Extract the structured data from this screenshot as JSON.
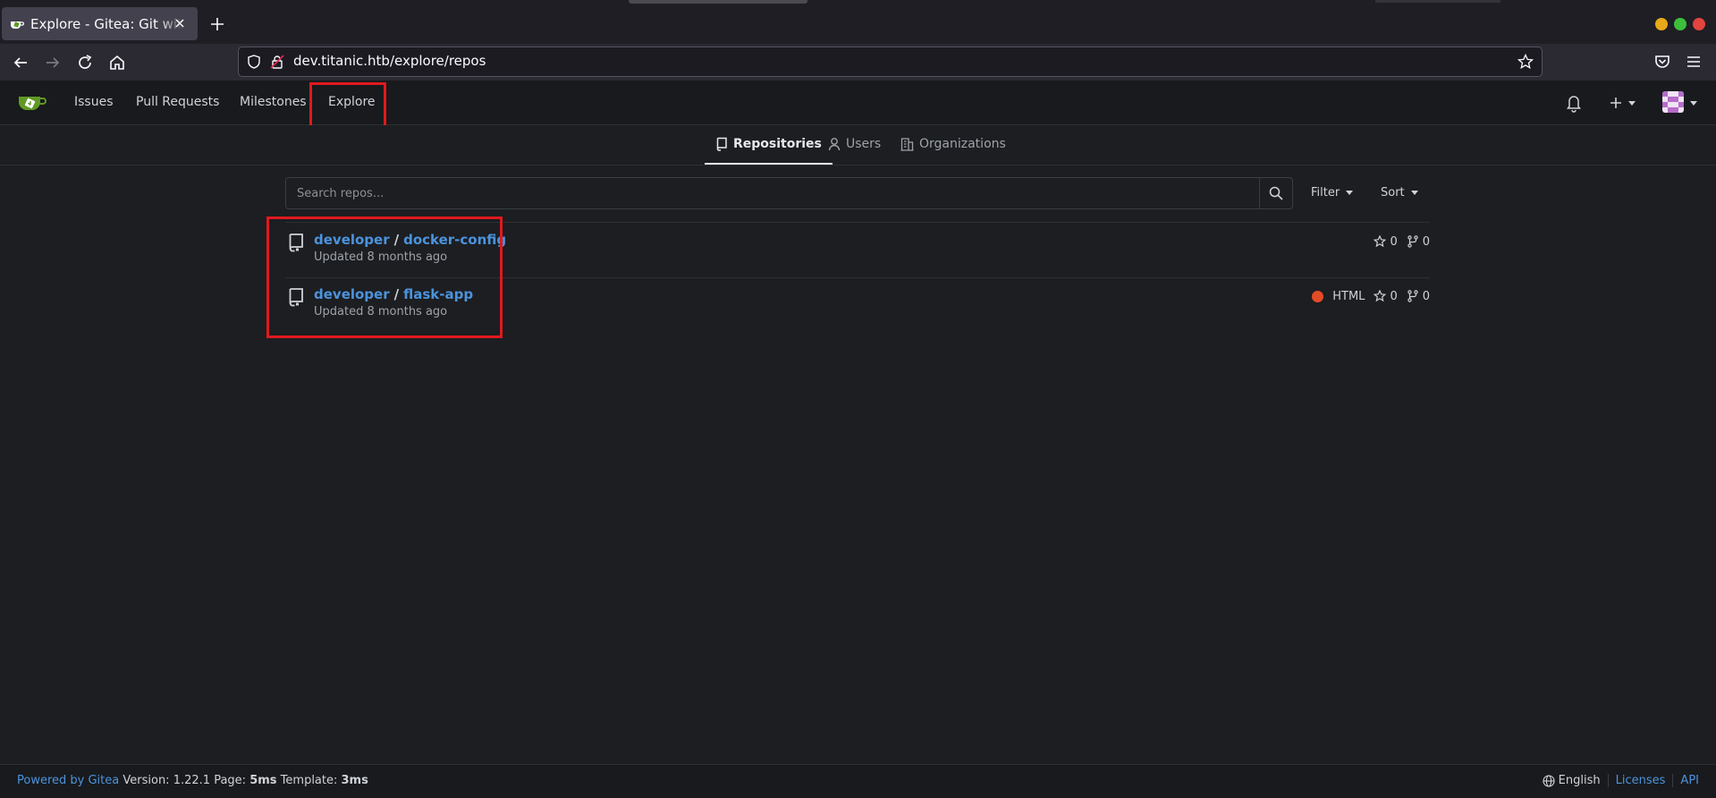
{
  "browser": {
    "tab_title": "Explore - Gitea: Git with a cup of tea",
    "url": "dev.titanic.htb/explore/repos"
  },
  "navbar": {
    "issues": "Issues",
    "pull_requests": "Pull Requests",
    "milestones": "Milestones",
    "explore": "Explore"
  },
  "tabs": {
    "repositories": "Repositories",
    "users": "Users",
    "organizations": "Organizations"
  },
  "search": {
    "placeholder": "Search repos...",
    "filter_label": "Filter",
    "sort_label": "Sort"
  },
  "repos": [
    {
      "owner": "developer",
      "name": "docker-config",
      "updated": "Updated 8 months ago",
      "language": "",
      "stars": "0",
      "forks": "0"
    },
    {
      "owner": "developer",
      "name": "flask-app",
      "updated": "Updated 8 months ago",
      "language": "HTML",
      "language_color": "#e34c26",
      "stars": "0",
      "forks": "0"
    }
  ],
  "footer": {
    "powered": "Powered by Gitea",
    "version": "Version: 1.22.1",
    "page_label": "Page:",
    "page_time": "5ms",
    "template_label": "Template:",
    "template_time": "3ms",
    "language": "English",
    "licenses": "Licenses",
    "api": "API"
  },
  "colors": {
    "accent": "#4c93dd",
    "highlight": "#e0191e",
    "background": "#1c1e22"
  }
}
